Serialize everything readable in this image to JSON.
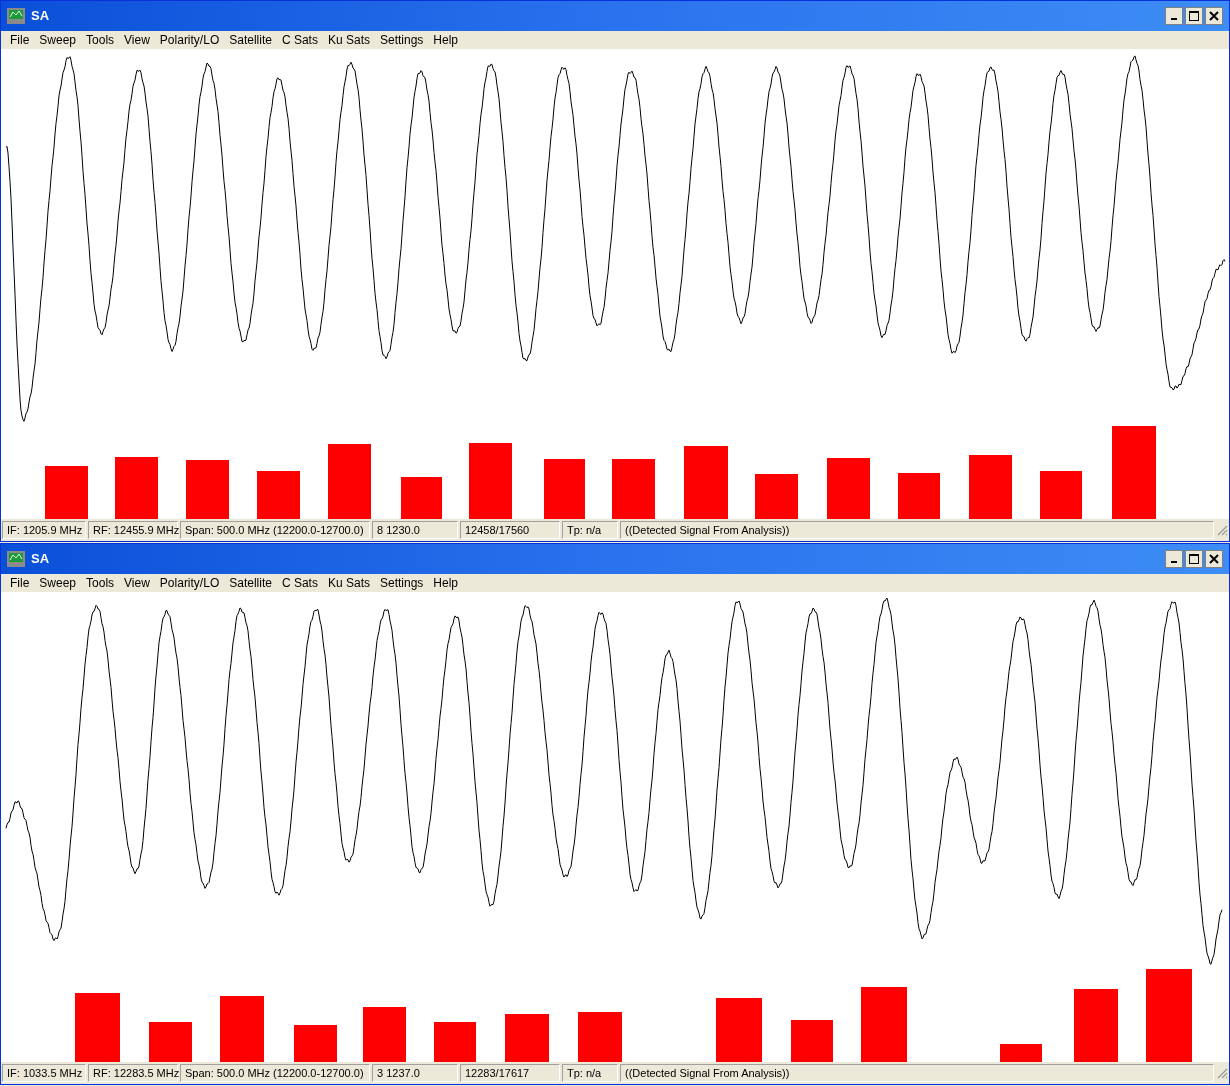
{
  "windows": [
    {
      "title": "SA",
      "menu": [
        "File",
        "Sweep",
        "Tools",
        "View",
        "Polarity/LO",
        "Satellite",
        "C Sats",
        "Ku Sats",
        "Settings",
        "Help"
      ],
      "status": [
        "IF: 1205.9 MHz",
        "RF: 12455.9 MHz",
        "Span: 500.0 MHz (12200.0-12700.0)",
        "8 1230.0",
        "12458/17560",
        "Tp: n/a",
        "((Detected Signal From Analysis))"
      ]
    },
    {
      "title": "SA",
      "menu": [
        "File",
        "Sweep",
        "Tools",
        "View",
        "Polarity/LO",
        "Satellite",
        "C Sats",
        "Ku Sats",
        "Settings",
        "Help"
      ],
      "status": [
        "IF: 1033.5 MHz",
        "RF: 12283.5 MHz",
        "Span: 500.0 MHz (12200.0-12700.0)",
        "3 1237.0",
        "12283/17617",
        "Tp: n/a",
        "((Detected Signal From Analysis))"
      ]
    }
  ]
}
